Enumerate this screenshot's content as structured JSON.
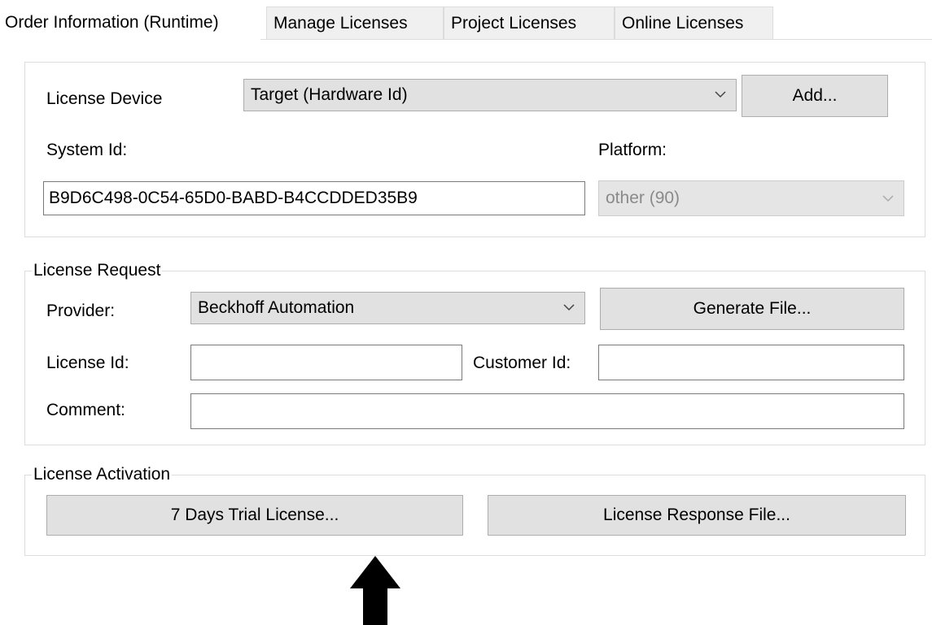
{
  "tabs": [
    {
      "label": "Order Information (Runtime)",
      "active": true
    },
    {
      "label": "Manage Licenses",
      "active": false
    },
    {
      "label": "Project Licenses",
      "active": false
    },
    {
      "label": "Online Licenses",
      "active": false
    }
  ],
  "device": {
    "license_device_label": "License Device",
    "license_device_value": "Target (Hardware Id)",
    "add_button": "Add...",
    "system_id_label": "System Id:",
    "system_id_value": "B9D6C498-0C54-65D0-BABD-B4CCDDED35B9",
    "platform_label": "Platform:",
    "platform_value": "other (90)"
  },
  "license_request": {
    "legend": "License Request",
    "provider_label": "Provider:",
    "provider_value": "Beckhoff Automation",
    "generate_button": "Generate File...",
    "license_id_label": "License Id:",
    "license_id_value": "",
    "customer_id_label": "Customer Id:",
    "customer_id_value": "",
    "comment_label": "Comment:",
    "comment_value": ""
  },
  "license_activation": {
    "legend": "License Activation",
    "trial_button": "7 Days Trial License...",
    "response_button": "License Response File..."
  },
  "icons": {
    "dropdown": "chevron-down-icon",
    "annotation": "arrow-up-icon"
  },
  "colors": {
    "button_bg": "#e1e1e1",
    "border": "#adadad",
    "disabled_text": "#8a8a8a",
    "arrow": "#000000"
  }
}
